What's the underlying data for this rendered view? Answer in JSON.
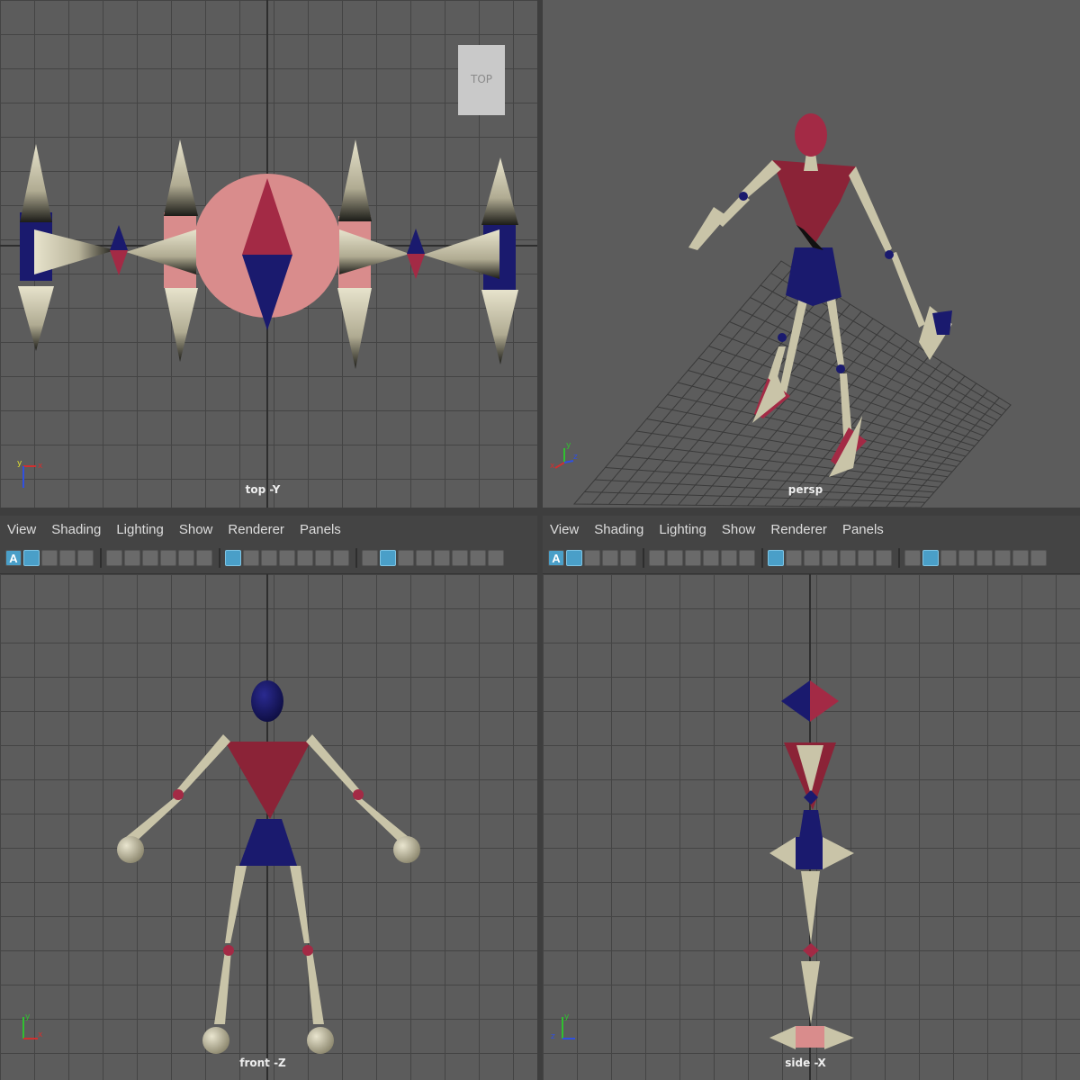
{
  "viewports": {
    "top": {
      "label": "top -Y",
      "view_cube": "TOP"
    },
    "persp": {
      "label": "persp"
    },
    "front": {
      "label": "front -Z"
    },
    "side": {
      "label": "side -X"
    }
  },
  "menu": [
    "View",
    "Shading",
    "Lighting",
    "Show",
    "Renderer",
    "Panels"
  ],
  "toolbar": {
    "first_icon_letter": "A"
  },
  "icons": [
    "select-camera-icon",
    "camera-attributes-icon",
    "bookmark-icon",
    "image-plane-icon",
    "grid-icon",
    "film-gate-icon",
    "resolution-gate-icon",
    "gate-mask-icon",
    "field-chart-icon",
    "safe-action-icon",
    "safe-title-icon",
    "wireframe-icon",
    "smooth-shade-icon",
    "default-material-icon",
    "textured-icon",
    "use-lights-icon",
    "shadows-icon",
    "isolate-select-icon"
  ],
  "colors": {
    "viewport_bg": "#5c5c5c",
    "grid_line": "#444444",
    "red_material": "#8b2337",
    "blue_material": "#1a1a6e",
    "bone_material": "#c9c4a8",
    "pink_material": "#d98c8c",
    "highlight": "#4a9fc8"
  }
}
